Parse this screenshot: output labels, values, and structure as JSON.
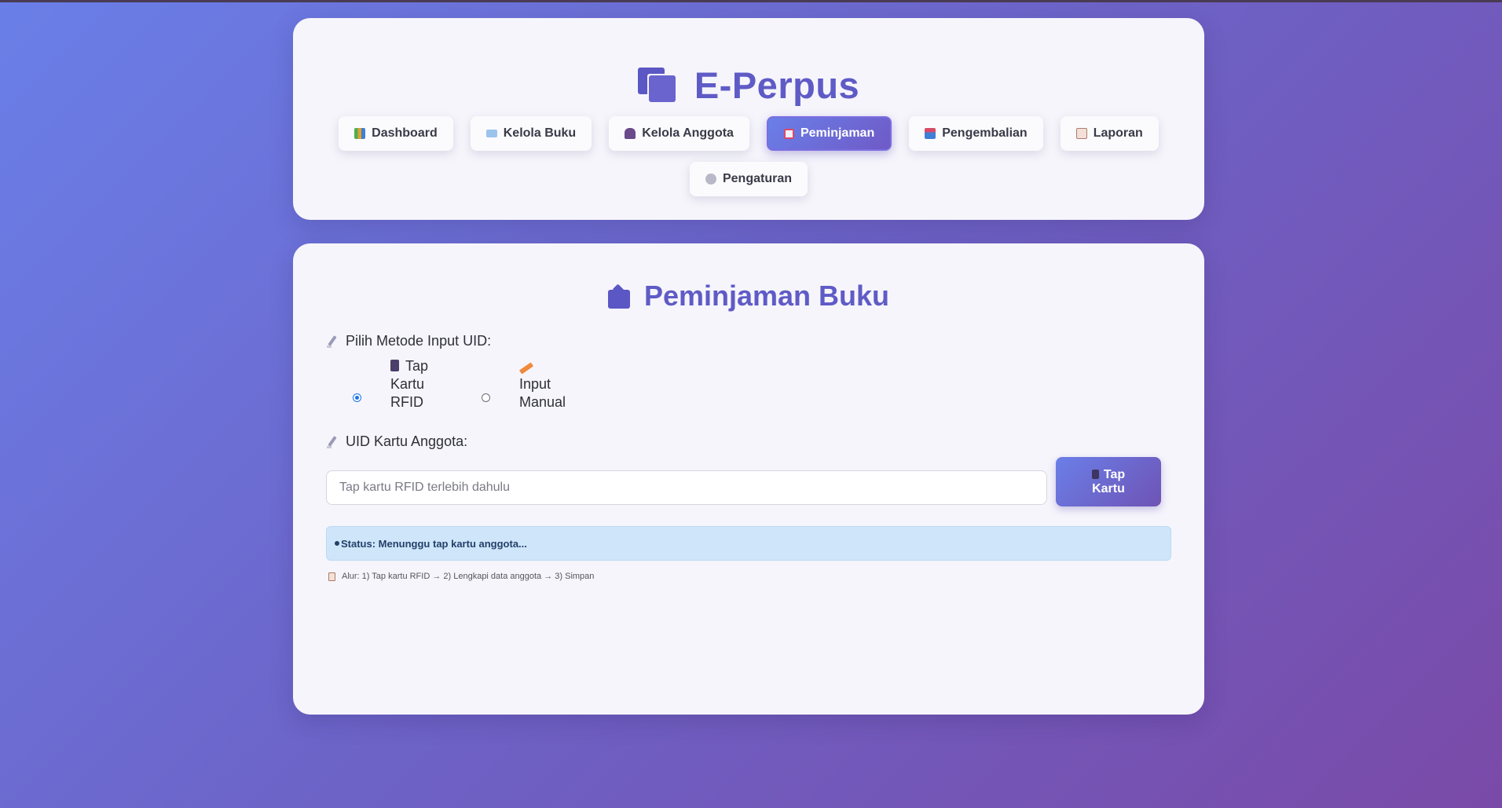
{
  "app": {
    "title": "E-Perpus"
  },
  "nav": {
    "items": [
      {
        "label": "Dashboard",
        "icon": "bar-chart-icon",
        "active": false
      },
      {
        "label": "Kelola Buku",
        "icon": "open-book-icon",
        "active": false
      },
      {
        "label": "Kelola Anggota",
        "icon": "people-icon",
        "active": false
      },
      {
        "label": "Peminjaman",
        "icon": "outbox-icon",
        "active": true
      },
      {
        "label": "Pengembalian",
        "icon": "inbox-icon",
        "active": false
      },
      {
        "label": "Laporan",
        "icon": "clipboard-icon",
        "active": false
      },
      {
        "label": "Pengaturan",
        "icon": "gear-icon",
        "active": false
      }
    ]
  },
  "main": {
    "title": "Peminjaman Buku",
    "method_label": "Pilih Metode Input UID:",
    "methods": [
      {
        "label_line1": "Tap",
        "label_line2": "Kartu",
        "label_line3": "RFID",
        "selected": true
      },
      {
        "label_line1": "Input",
        "label_line2": "Manual",
        "selected": false
      }
    ],
    "uid_label": "UID Kartu Anggota:",
    "uid_input": {
      "value": "",
      "placeholder": "Tap kartu RFID terlebih dahulu"
    },
    "tap_button": {
      "line1": "Tap",
      "line2": "Kartu"
    },
    "status_text": "Status: Menunggu tap kartu anggota...",
    "hint_text": "Alur: 1) Tap kartu RFID → 2) Lengkapi data anggota → 3) Simpan"
  },
  "colors": {
    "accent": "#5f5bc6",
    "active_nav_start": "#6a7fe8",
    "active_nav_end": "#6f5ac7",
    "status_bg": "#cfe6fa"
  }
}
